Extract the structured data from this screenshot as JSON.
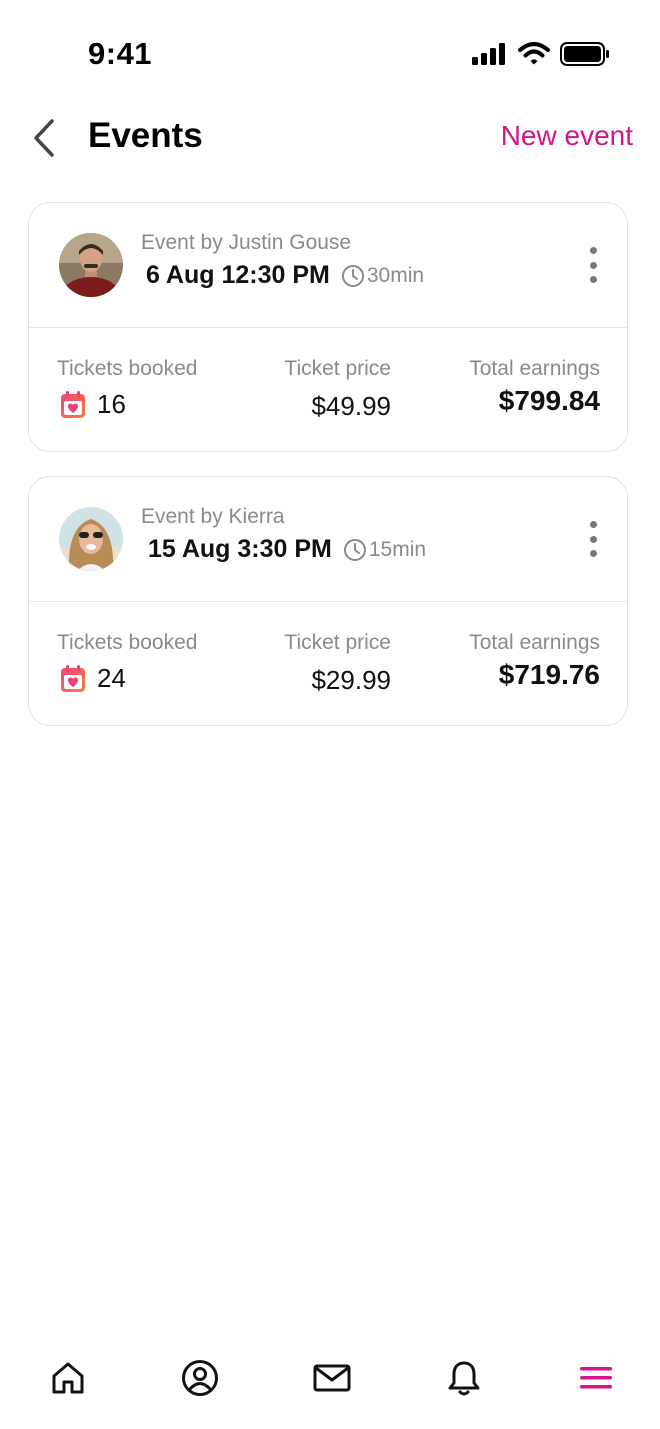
{
  "status_bar": {
    "time": "9:41"
  },
  "header": {
    "title": "Events",
    "new_event_label": "New event"
  },
  "events": [
    {
      "host_line": "Event by Justin Gouse",
      "date_time": "6 Aug 12:30 PM",
      "duration": "30min",
      "labels": {
        "booked": "Tickets booked",
        "price": "Ticket price",
        "earnings": "Total earnings"
      },
      "tickets_booked": "16",
      "ticket_price": "$49.99",
      "total_earnings": "$799.84"
    },
    {
      "host_line": "Event by Kierra",
      "date_time": "15 Aug 3:30 PM",
      "duration": "15min",
      "labels": {
        "booked": "Tickets booked",
        "price": "Ticket price",
        "earnings": "Total earnings"
      },
      "tickets_booked": "24",
      "ticket_price": "$29.99",
      "total_earnings": "$719.76"
    }
  ],
  "nav": {
    "items": [
      {
        "icon": "home-icon"
      },
      {
        "icon": "profile-icon"
      },
      {
        "icon": "mail-icon"
      },
      {
        "icon": "bell-icon"
      },
      {
        "icon": "menu-icon",
        "active": true
      }
    ]
  },
  "colors": {
    "accent": "#d1158d",
    "muted": "#8a8a8a",
    "divider": "#e6e6e6"
  }
}
